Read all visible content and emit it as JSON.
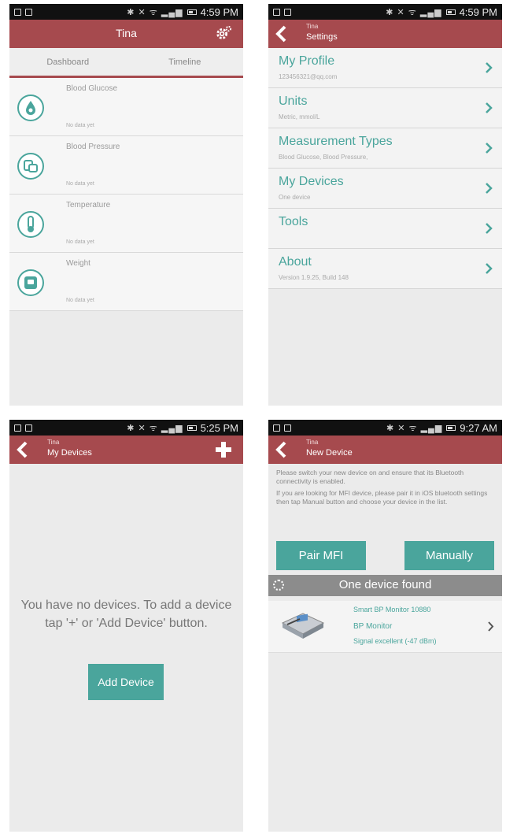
{
  "colors": {
    "brand": "#a64a4e",
    "accent": "#4aa59c",
    "background": "#ebebeb"
  },
  "dashboard_screen": {
    "status_time": "4:59 PM",
    "title": "Tina",
    "tabs": [
      {
        "label": "Dashboard",
        "active": true
      },
      {
        "label": "Timeline",
        "active": false
      }
    ],
    "items": [
      {
        "name": "Blood Glucose",
        "status": "No data yet",
        "icon": "blood-drop-icon"
      },
      {
        "name": "Blood Pressure",
        "status": "No data yet",
        "icon": "blood-pressure-icon"
      },
      {
        "name": "Temperature",
        "status": "No data yet",
        "icon": "thermometer-icon"
      },
      {
        "name": "Weight",
        "status": "No data yet",
        "icon": "scale-icon"
      }
    ]
  },
  "settings_screen": {
    "status_time": "4:59 PM",
    "user": "Tina",
    "title": "Settings",
    "items": [
      {
        "title": "My Profile",
        "subtitle": "123456321@qq.com"
      },
      {
        "title": "Units",
        "subtitle": "Metric, mmol/L"
      },
      {
        "title": "Measurement Types",
        "subtitle": "Blood Glucose, Blood Pressure,"
      },
      {
        "title": "My Devices",
        "subtitle": "One device"
      },
      {
        "title": "Tools",
        "subtitle": ""
      },
      {
        "title": "About",
        "subtitle": "Version 1.9.25, Build 148"
      }
    ]
  },
  "my_devices_screen": {
    "status_time": "5:25 PM",
    "user": "Tina",
    "title": "My Devices",
    "empty_message": "You have no devices. To add a device tap '+' or 'Add Device' button.",
    "add_button": "Add Device"
  },
  "new_device_screen": {
    "status_time": "9:27 AM",
    "user": "Tina",
    "title": "New Device",
    "instructions": [
      "Please switch your new device on and ensure that its Bluetooth connectivity is enabled.",
      "If you are looking for MFI device, please pair it in iOS bluetooth settings then tap Manual button and choose your device in the list."
    ],
    "pair_button": "Pair MFI",
    "manual_button": "Manually",
    "found_text": "One device found",
    "device": {
      "name": "Smart BP Monitor 10880",
      "type": "BP Monitor",
      "signal": "Signal excellent (-47 dBm)"
    }
  }
}
